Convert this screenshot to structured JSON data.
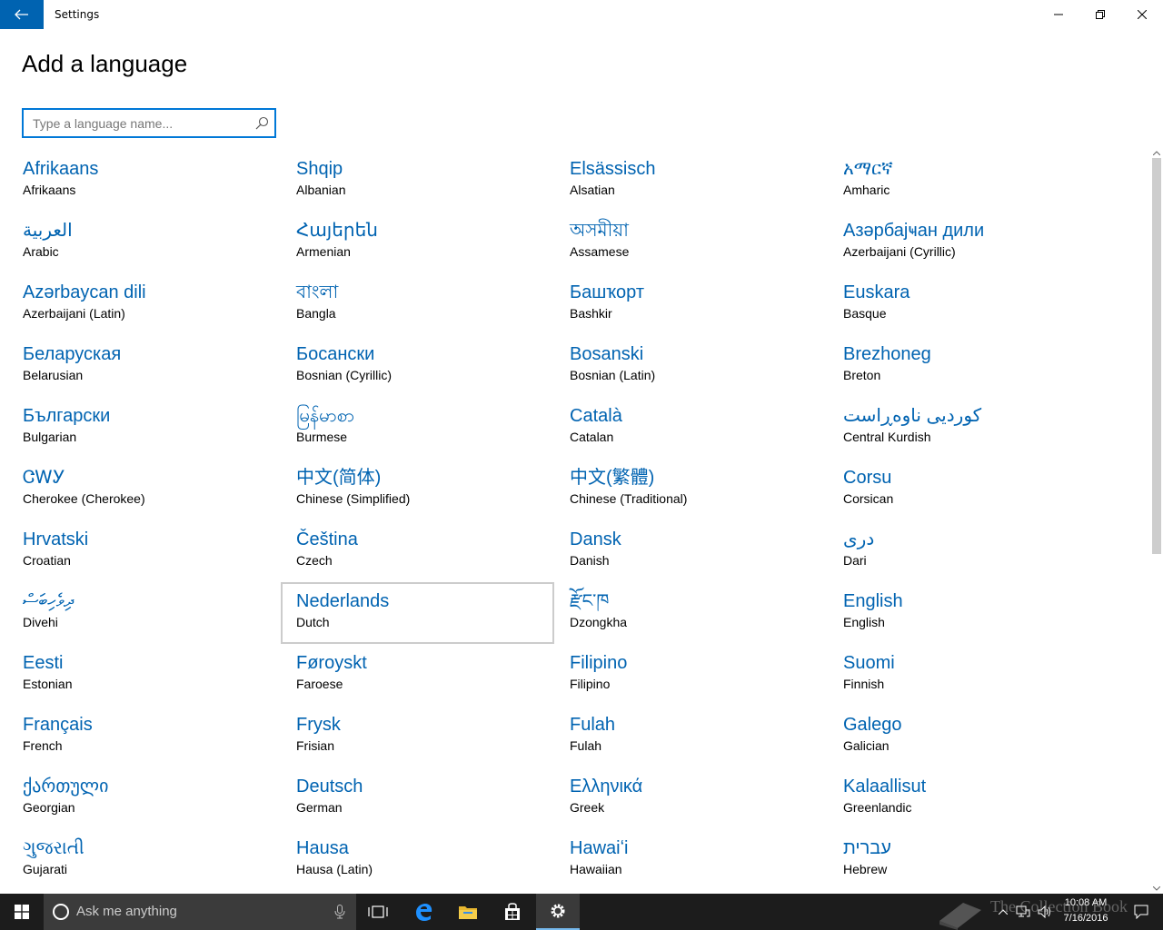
{
  "window": {
    "title": "Settings",
    "controls": {
      "minimize": "minimize-icon",
      "maximize": "restore-icon",
      "close": "close-icon"
    }
  },
  "page": {
    "title": "Add a language",
    "search": {
      "placeholder": "Type a language name...",
      "value": ""
    }
  },
  "languages": [
    {
      "native": "Afrikaans",
      "english": "Afrikaans"
    },
    {
      "native": "Shqip",
      "english": "Albanian"
    },
    {
      "native": "Elsässisch",
      "english": "Alsatian"
    },
    {
      "native": "አማርኛ",
      "english": "Amharic"
    },
    {
      "native": "العربية",
      "english": "Arabic"
    },
    {
      "native": "Հայերեն",
      "english": "Armenian"
    },
    {
      "native": "অসমীয়া",
      "english": "Assamese"
    },
    {
      "native": "Азәрбајҹан дили",
      "english": "Azerbaijani (Cyrillic)"
    },
    {
      "native": "Azərbaycan dili",
      "english": "Azerbaijani (Latin)"
    },
    {
      "native": "বাংলা",
      "english": "Bangla"
    },
    {
      "native": "Башҡорт",
      "english": "Bashkir"
    },
    {
      "native": "Euskara",
      "english": "Basque"
    },
    {
      "native": "Беларуская",
      "english": "Belarusian"
    },
    {
      "native": "Босански",
      "english": "Bosnian (Cyrillic)"
    },
    {
      "native": "Bosanski",
      "english": "Bosnian (Latin)"
    },
    {
      "native": "Brezhoneg",
      "english": "Breton"
    },
    {
      "native": "Български",
      "english": "Bulgarian"
    },
    {
      "native": "မြန်မာစာ",
      "english": "Burmese"
    },
    {
      "native": "Català",
      "english": "Catalan"
    },
    {
      "native": "کوردیی ناوەڕاست",
      "english": "Central Kurdish"
    },
    {
      "native": "ᏣᎳᎩ",
      "english": "Cherokee (Cherokee)"
    },
    {
      "native": "中文(简体)",
      "english": "Chinese (Simplified)"
    },
    {
      "native": "中文(繁體)",
      "english": "Chinese (Traditional)"
    },
    {
      "native": "Corsu",
      "english": "Corsican"
    },
    {
      "native": "Hrvatski",
      "english": "Croatian"
    },
    {
      "native": "Čeština",
      "english": "Czech"
    },
    {
      "native": "Dansk",
      "english": "Danish"
    },
    {
      "native": "دری",
      "english": "Dari"
    },
    {
      "native": "ދިވެހިބަސް",
      "english": "Divehi"
    },
    {
      "native": "Nederlands",
      "english": "Dutch"
    },
    {
      "native": "རྫོང་ཁ",
      "english": "Dzongkha"
    },
    {
      "native": "English",
      "english": "English"
    },
    {
      "native": "Eesti",
      "english": "Estonian"
    },
    {
      "native": "Føroyskt",
      "english": "Faroese"
    },
    {
      "native": "Filipino",
      "english": "Filipino"
    },
    {
      "native": "Suomi",
      "english": "Finnish"
    },
    {
      "native": "Français",
      "english": "French"
    },
    {
      "native": "Frysk",
      "english": "Frisian"
    },
    {
      "native": "Fulah",
      "english": "Fulah"
    },
    {
      "native": "Galego",
      "english": "Galician"
    },
    {
      "native": "ქართული",
      "english": "Georgian"
    },
    {
      "native": "Deutsch",
      "english": "German"
    },
    {
      "native": "Ελληνικά",
      "english": "Greek"
    },
    {
      "native": "Kalaallisut",
      "english": "Greenlandic"
    },
    {
      "native": "ગુજરાતી",
      "english": "Gujarati"
    },
    {
      "native": "Hausa",
      "english": "Hausa (Latin)"
    },
    {
      "native": "Hawaiʻi",
      "english": "Hawaiian"
    },
    {
      "native": "עברית",
      "english": "Hebrew"
    }
  ],
  "focused_index": 29,
  "taskbar": {
    "search_text": "Ask me anything",
    "apps": [
      "task-view-icon",
      "edge-icon",
      "file-explorer-icon",
      "store-icon",
      "settings-icon"
    ],
    "time": "10:08 AM",
    "date": "7/16/2016"
  },
  "watermark": "The Collection Book",
  "colors": {
    "accent": "#0063b1",
    "focus_border": "#0078d7",
    "taskbar": "#1c1c1c"
  }
}
